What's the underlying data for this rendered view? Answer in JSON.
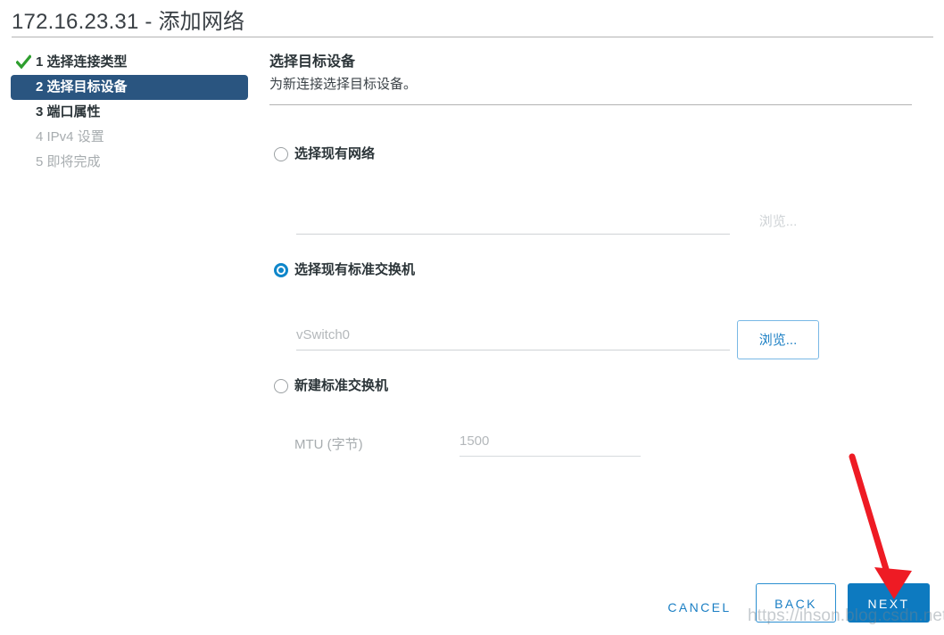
{
  "window": {
    "title": "172.16.23.31 - 添加网络"
  },
  "wizard": {
    "steps": [
      {
        "label": "1 选择连接类型",
        "state": "done"
      },
      {
        "label": "2 选择目标设备",
        "state": "active"
      },
      {
        "label": "3 端口属性",
        "state": "pending-bold"
      },
      {
        "label": "4 IPv4 设置",
        "state": "pending"
      },
      {
        "label": "5 即将完成",
        "state": "pending"
      }
    ]
  },
  "main": {
    "title": "选择目标设备",
    "subtitle": "为新连接选择目标设备。",
    "options": [
      {
        "label": "选择现有网络",
        "selected": false,
        "input_value": "",
        "input_placeholder": "",
        "browse_label": "浏览...",
        "browse_enabled": false
      },
      {
        "label": "选择现有标准交换机",
        "selected": true,
        "input_value": "",
        "input_placeholder": "vSwitch0",
        "browse_label": "浏览...",
        "browse_enabled": true
      },
      {
        "label": "新建标准交换机",
        "selected": false,
        "mtu_label": "MTU (字节)",
        "mtu_value": "",
        "mtu_placeholder": "1500"
      }
    ]
  },
  "footer": {
    "cancel_label": "CANCEL",
    "back_label": "BACK",
    "next_label": "NEXT"
  },
  "annotations": {
    "watermark": "https://ihson.blog.csdn.net"
  },
  "colors": {
    "accent_blue": "#0d7ac0",
    "step_active_bg": "#2a5580",
    "radio_blue": "#0e86ca",
    "check_green": "#2e9e2e",
    "arrow_red": "#ee1b24"
  }
}
